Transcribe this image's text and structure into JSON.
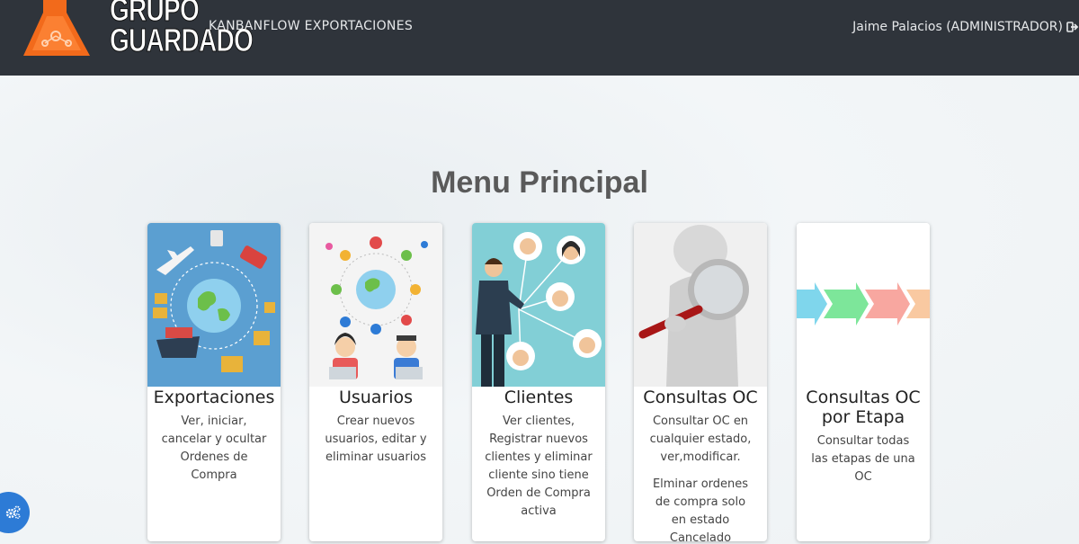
{
  "brand": {
    "line1": "GRUPO",
    "line2": "GUARDADO"
  },
  "nav": {
    "title": "KANBANFLOW EXPORTACIONES",
    "user": "Jaime Palacios (ADMINISTRADOR)"
  },
  "main": {
    "title": "Menu Principal",
    "cards": [
      {
        "title": "Exportaciones",
        "desc": "Ver, iniciar, cancelar y ocultar Ordenes de Compra",
        "desc2": ""
      },
      {
        "title": "Usuarios",
        "desc": "Crear nuevos usuarios, editar y eliminar usuarios",
        "desc2": ""
      },
      {
        "title": "Clientes",
        "desc": "Ver clientes, Registrar nuevos clientes y eliminar cliente sino tiene Orden de Compra activa",
        "desc2": ""
      },
      {
        "title": "Consultas OC",
        "desc": "Consultar OC en cualquier estado, ver,modificar.",
        "desc2": "Elminar ordenes de compra solo en estado Cancelado"
      },
      {
        "title": "Consultas OC por Etapa",
        "desc": "Consultar todas las etapas de una OC",
        "desc2": ""
      }
    ]
  },
  "icons": {
    "logout": "sign-out-icon",
    "settings": "cogs-icon",
    "logo": "flask-logo"
  },
  "colors": {
    "navbar": "#2f343b",
    "logo_orange": "#f26a1b",
    "fab_blue": "#2d7bd6",
    "exportaciones_bg": "#5b9fd1",
    "clientes_bg": "#82cfd6"
  }
}
